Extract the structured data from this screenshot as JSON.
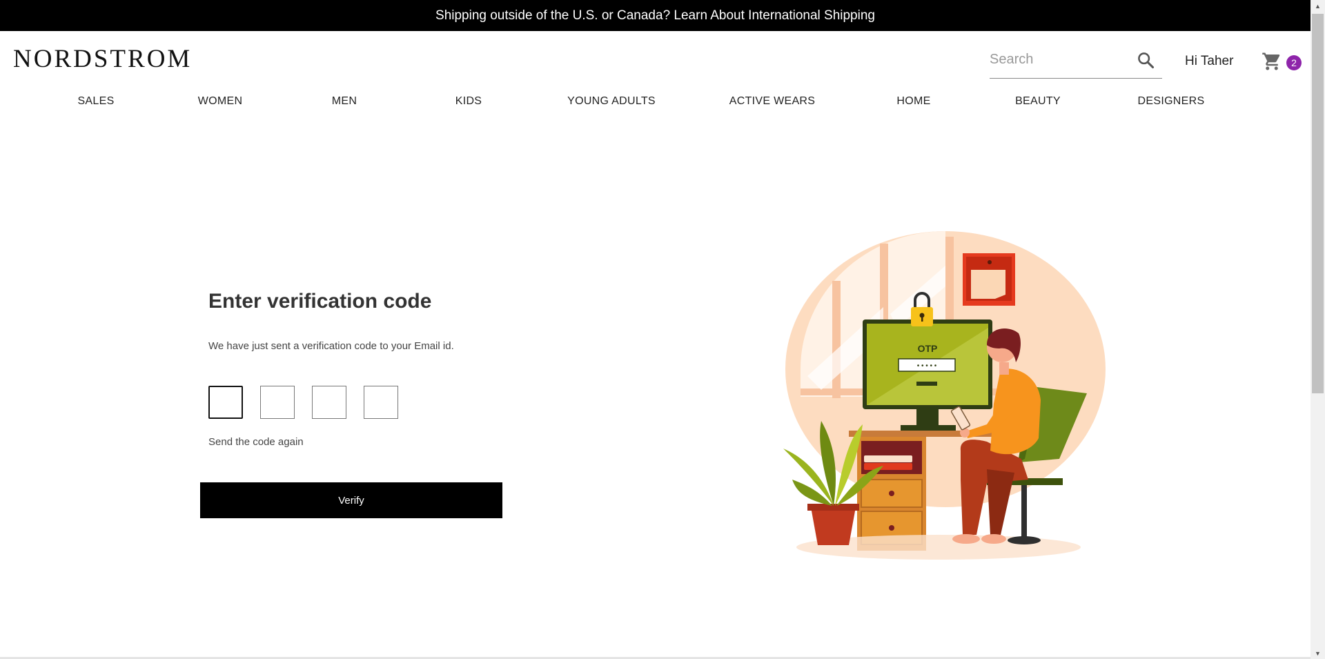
{
  "promo": {
    "text": "Shipping outside of the U.S. or Canada? Learn About International Shipping"
  },
  "header": {
    "logo": "NORDSTROM",
    "search": {
      "placeholder": "Search",
      "value": "",
      "icon": "search-icon"
    },
    "greeting": "Hi Taher",
    "cart": {
      "icon": "cart-icon",
      "count": "2"
    }
  },
  "nav": {
    "items": [
      {
        "label": "SALES"
      },
      {
        "label": "WOMEN"
      },
      {
        "label": "MEN"
      },
      {
        "label": "KIDS"
      },
      {
        "label": "YOUNG ADULTS"
      },
      {
        "label": "ACTIVE WEARS"
      },
      {
        "label": "HOME"
      },
      {
        "label": "BEAUTY"
      },
      {
        "label": "DESIGNERS"
      }
    ]
  },
  "verification": {
    "title": "Enter verification code",
    "subtitle": "We have just sent a verification code to your Email id.",
    "digits": [
      "",
      "",
      "",
      ""
    ],
    "resend_label": "Send the code again",
    "verify_label": "Verify"
  },
  "illustration": {
    "screen_label": "OTP",
    "password_mask": "• • • • •"
  },
  "colors": {
    "promo_bg": "#000000",
    "badge": "#8e24aa",
    "button_bg": "#000000"
  }
}
